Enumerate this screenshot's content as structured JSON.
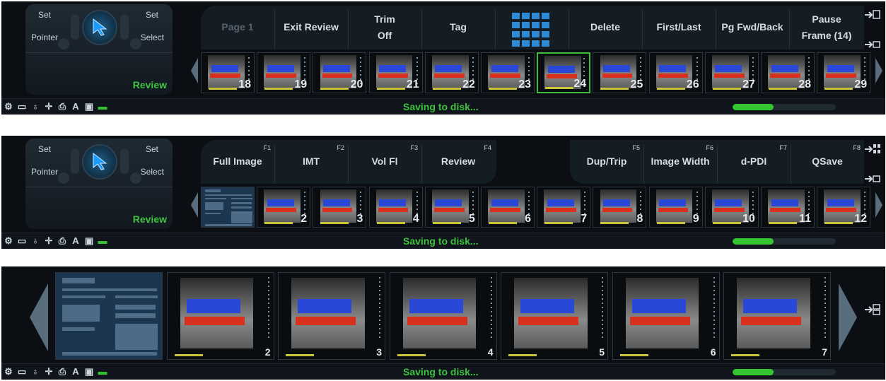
{
  "status": {
    "message": "Saving to disk...",
    "progress_fraction": 0.4
  },
  "status_icons": [
    "gear-icon",
    "folder-icon",
    "probe-icon",
    "crosshair-icon",
    "printer-icon",
    "text-a-icon",
    "media-icon",
    "battery-icon"
  ],
  "control": {
    "set_left": "Set",
    "set_right": "Set",
    "pointer": "Pointer",
    "select": "Select",
    "review": "Review"
  },
  "panel1": {
    "keys": [
      {
        "label": "Page 1",
        "dim": true
      },
      {
        "label": "Exit Review"
      },
      {
        "label": "Trim\nOff"
      },
      {
        "label": "Tag"
      },
      {
        "label": "",
        "grid": true
      },
      {
        "label": "Delete"
      },
      {
        "label": "First/Last"
      },
      {
        "label": "Pg Fwd/Back"
      },
      {
        "label": "Pause\nFrame (14)"
      }
    ],
    "thumbs": [
      "18",
      "19",
      "20",
      "21",
      "22",
      "23",
      "24",
      "25",
      "26",
      "27",
      "28",
      "29"
    ],
    "selected": "24"
  },
  "panel2": {
    "keys": [
      {
        "label": "Full Image",
        "fkey": "F1"
      },
      {
        "label": "IMT",
        "fkey": "F2"
      },
      {
        "label": "Vol Fl",
        "fkey": "F3"
      },
      {
        "label": "Review",
        "fkey": "F4"
      },
      {
        "label": "Dup/Trip",
        "fkey": "F5"
      },
      {
        "label": "Image Width",
        "fkey": "F6"
      },
      {
        "label": "d-PDI",
        "fkey": "F7"
      },
      {
        "label": "QSave",
        "fkey": "F8"
      }
    ],
    "thumbs": [
      "",
      "2",
      "3",
      "4",
      "5",
      "6",
      "7",
      "8",
      "9",
      "10",
      "11",
      "12"
    ]
  },
  "panel3": {
    "thumbs": [
      "",
      "2",
      "3",
      "4",
      "5",
      "6",
      "7"
    ]
  },
  "colors": {
    "accent": "#3fc23f",
    "doppler_blue": "#2a48d8",
    "doppler_red": "#d8301c"
  }
}
